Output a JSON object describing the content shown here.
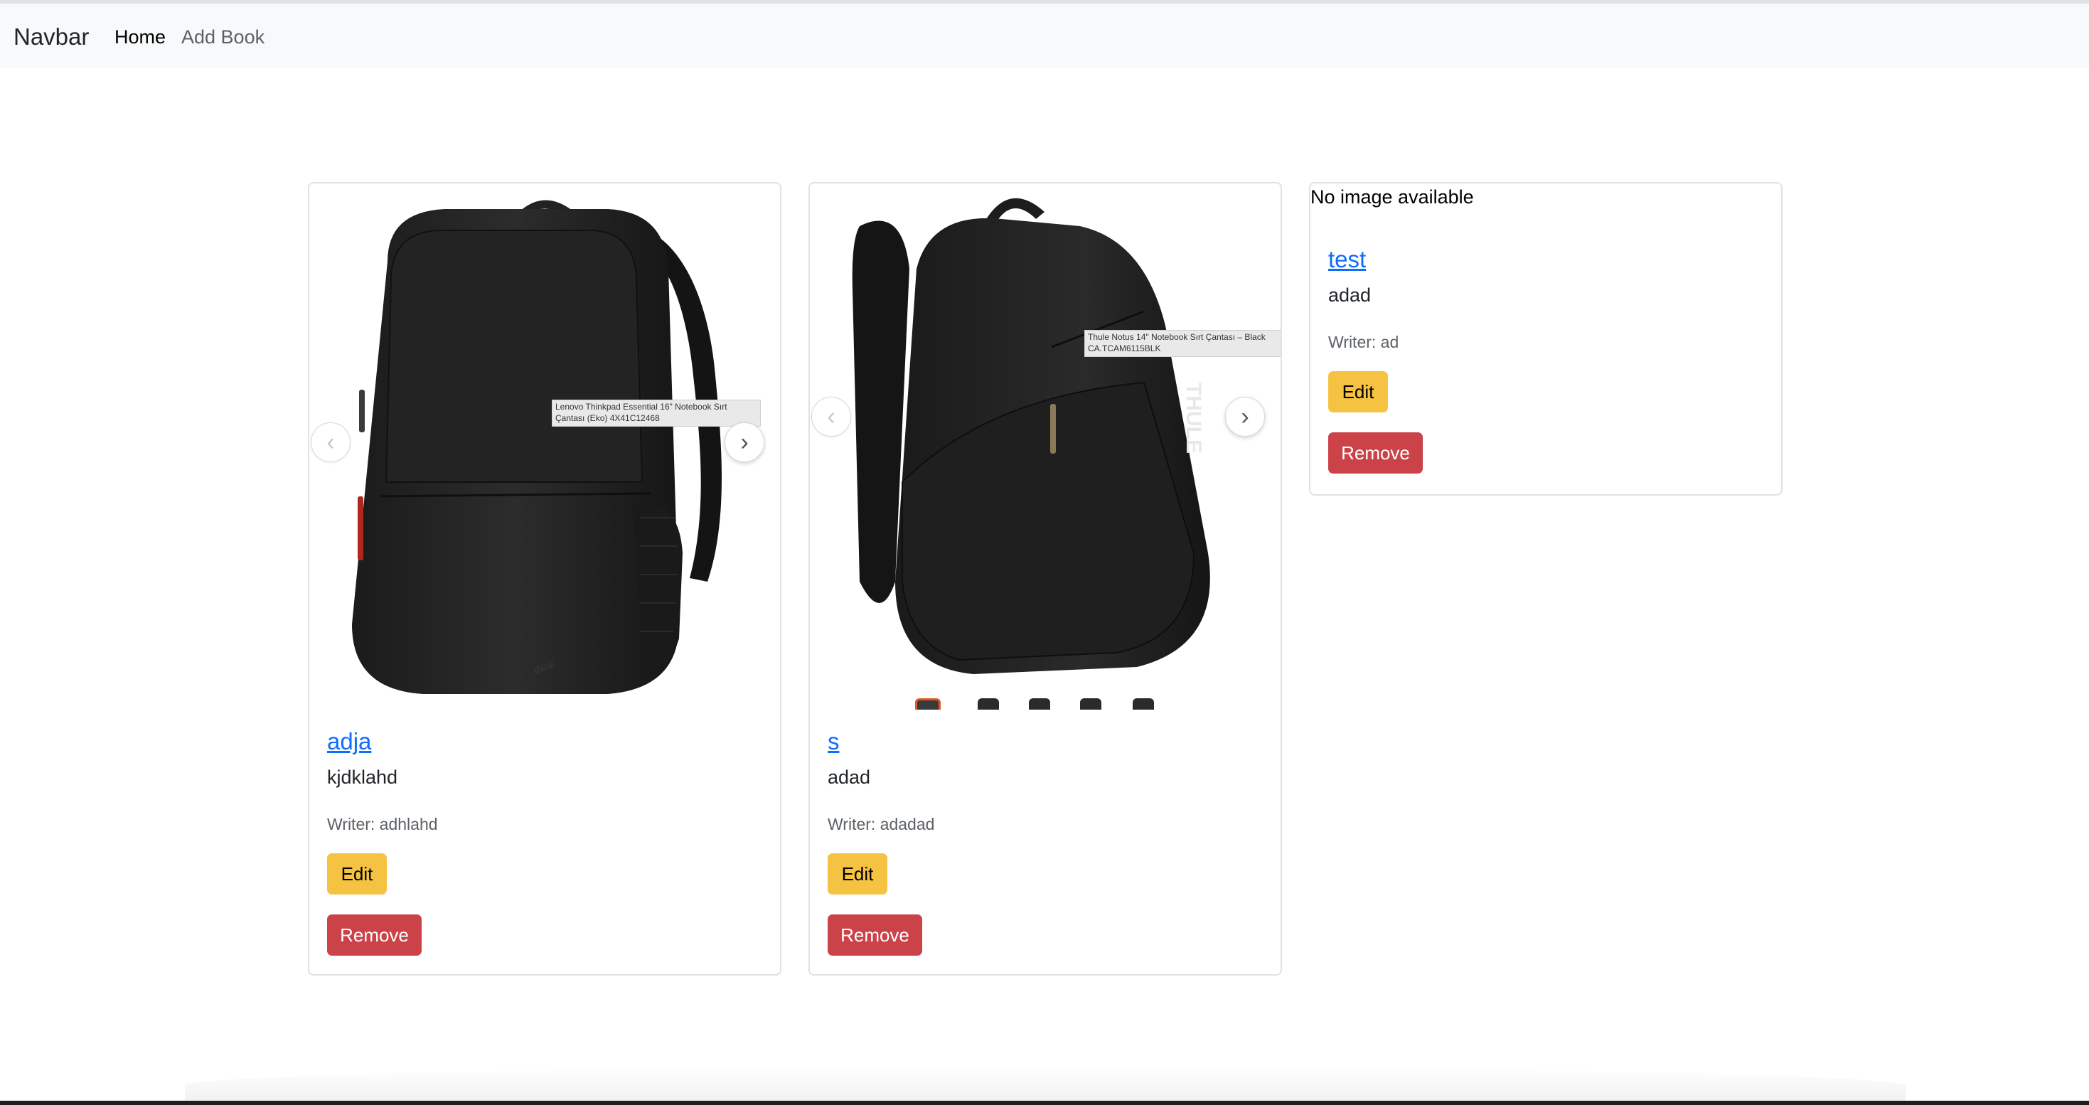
{
  "navbar": {
    "brand": "Navbar",
    "links": [
      {
        "label": "Home"
      },
      {
        "label": "Add Book"
      }
    ]
  },
  "cards": [
    {
      "title": "adja",
      "description": "kjdklahd",
      "writer": "Writer: adhlahd",
      "edit_label": "Edit",
      "remove_label": "Remove",
      "image_tooltip": "Lenovo Thinkpad Essential 16\" Notebook Sırt\nÇantası (Eko) 4X41C12468",
      "prev_icon": "chevron-left-icon",
      "next_icon": "chevron-right-icon"
    },
    {
      "title": "s",
      "description": "adad",
      "writer": "Writer: adadad",
      "edit_label": "Edit",
      "remove_label": "Remove",
      "image_tooltip": "Thule Notus 14\" Notebook Sırt Çantası – Black\nCA.TCAM6115BLK",
      "thumbnail_count": 5,
      "active_thumbnail": 1,
      "thumbnail_active_color": "#e2572b"
    },
    {
      "no_image_text": "No image available",
      "title": "test",
      "description": "adad",
      "writer": "Writer: ad",
      "edit_label": "Edit",
      "remove_label": "Remove"
    }
  ],
  "colors": {
    "link": "#0d6efd",
    "edit_button": "#f5c242",
    "remove_button": "#cb4249",
    "navbar_bg": "#f8f9fa"
  }
}
